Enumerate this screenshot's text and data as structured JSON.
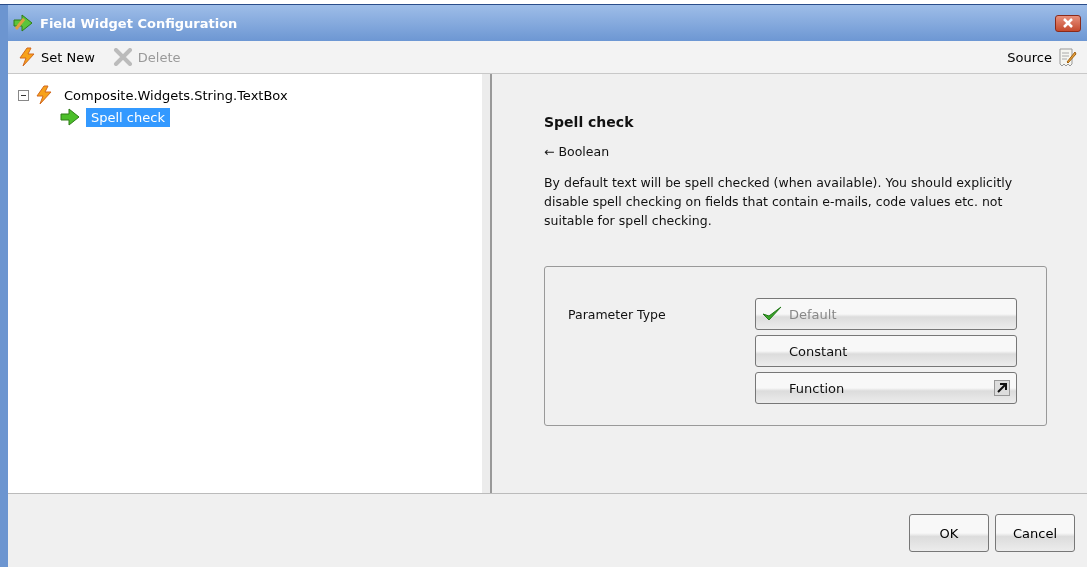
{
  "window": {
    "title": "Field Widget Configuration"
  },
  "toolbar": {
    "items": [
      {
        "label": "Set New",
        "kind": "new",
        "disabled": false
      },
      {
        "label": "Delete",
        "kind": "delete",
        "disabled": true
      }
    ],
    "source": "Source"
  },
  "tree": [
    {
      "label": "Composite.Widgets.String.TextBox",
      "expanded": true,
      "selected": false,
      "children": [
        {
          "label": "Spell check",
          "selected": true
        }
      ]
    }
  ],
  "detail": {
    "title": "Spell check",
    "type": "← Boolean",
    "description": "By default text will be spell checked (when available). You should explicitly disable spell checking on fields that contain e-mails, code values etc. not suitable for spell checking.",
    "parameter_label": "Parameter Type",
    "options": [
      {
        "label": "Default",
        "selected": true,
        "kind": "plain"
      },
      {
        "label": "Constant",
        "selected": false,
        "kind": "plain"
      },
      {
        "label": "Function",
        "selected": false,
        "kind": "popup"
      }
    ]
  },
  "buttons": [
    "OK",
    "Cancel"
  ]
}
